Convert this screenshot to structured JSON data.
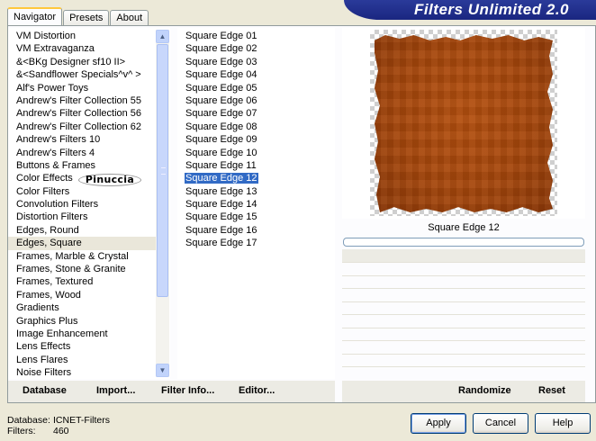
{
  "tabs": [
    "Navigator",
    "Presets",
    "About"
  ],
  "banner": "Filters Unlimited 2.0",
  "categories": [
    "VM Distortion",
    "VM Extravaganza",
    "&<BKg Designer sf10 II>",
    "&<Sandflower Specials^v^ >",
    "Alf's Power Toys",
    "Andrew's Filter Collection 55",
    "Andrew's Filter Collection 56",
    "Andrew's Filter Collection 62",
    "Andrew's Filters 10",
    "Andrew's Filters 4",
    "Buttons & Frames",
    "Color Effects",
    "Color Filters",
    "Convolution Filters",
    "Distortion Filters",
    "Edges, Round",
    "Edges, Square",
    "Frames, Marble & Crystal",
    "Frames, Stone & Granite",
    "Frames, Textured",
    "Frames, Wood",
    "Gradients",
    "Graphics Plus",
    "Image Enhancement",
    "Lens Effects",
    "Lens Flares",
    "Noise Filters"
  ],
  "selected_category": "Edges, Square",
  "watermark": "Pinuccia",
  "filters": [
    "Square Edge 01",
    "Square Edge 02",
    "Square Edge 03",
    "Square Edge 04",
    "Square Edge 05",
    "Square Edge 06",
    "Square Edge 07",
    "Square Edge 08",
    "Square Edge 09",
    "Square Edge 10",
    "Square Edge 11",
    "Square Edge 12",
    "Square Edge 13",
    "Square Edge 14",
    "Square Edge 15",
    "Square Edge 16",
    "Square Edge 17"
  ],
  "selected_filter": "Square Edge 12",
  "preview": {
    "filter_name": "Square Edge 12",
    "image_color": "#a5460b"
  },
  "links": {
    "database": "Database",
    "import": "Import...",
    "filter_info": "Filter Info...",
    "editor": "Editor..."
  },
  "actions": {
    "randomize": "Randomize",
    "reset": "Reset"
  },
  "info": {
    "database_label": "Database:",
    "database_value": "ICNET-Filters",
    "filters_label": "Filters:",
    "filters_value": "460"
  },
  "buttons": {
    "apply": "Apply",
    "cancel": "Cancel",
    "help": "Help"
  }
}
